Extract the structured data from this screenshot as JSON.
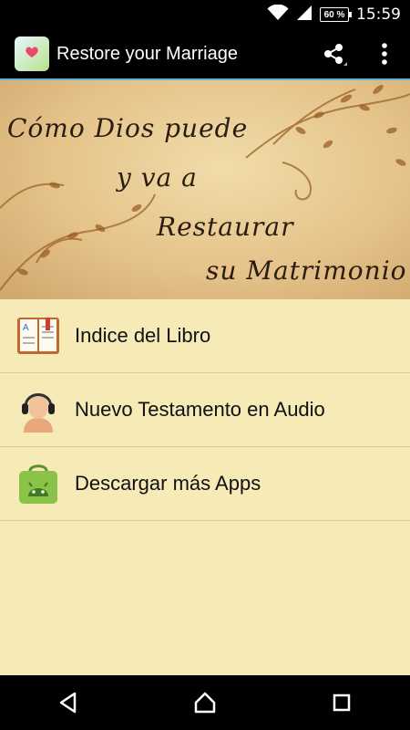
{
  "status_bar": {
    "battery": "60 %",
    "time": "15:59"
  },
  "app_bar": {
    "title": "Restore your Marriage"
  },
  "banner": {
    "line1": "Cómo Dios puede",
    "line2": "y va a",
    "line3": "Restaurar",
    "line4": "su Matrimonio"
  },
  "menu": {
    "items": [
      {
        "label": "Indice del Libro",
        "icon": "book-icon"
      },
      {
        "label": "Nuevo Testamento en Audio",
        "icon": "headphones-woman-icon"
      },
      {
        "label": "Descargar más Apps",
        "icon": "android-bag-icon"
      }
    ]
  }
}
